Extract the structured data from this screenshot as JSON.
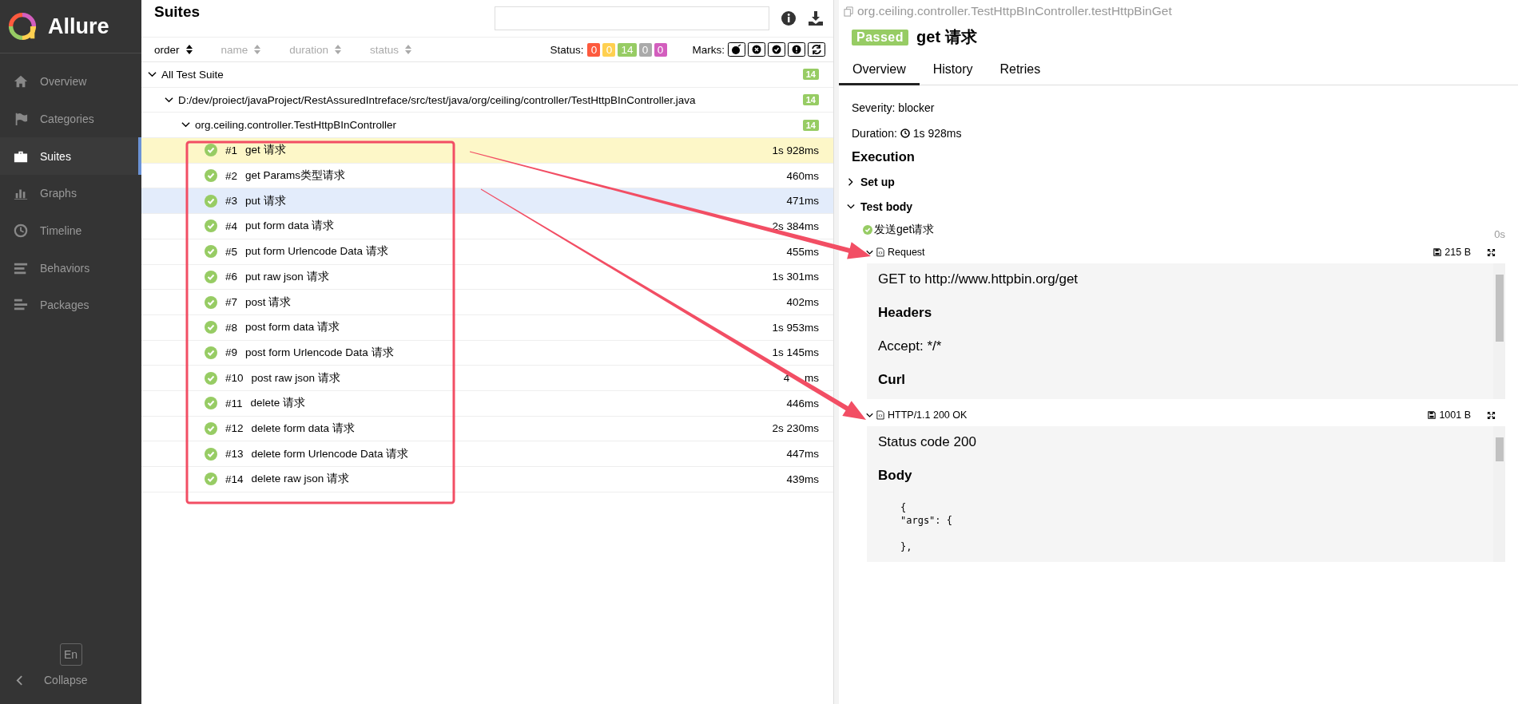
{
  "sidebar": {
    "logo": "Allure",
    "items": [
      {
        "label": "Overview",
        "selected": false
      },
      {
        "label": "Categories",
        "selected": false
      },
      {
        "label": "Suites",
        "selected": true
      },
      {
        "label": "Graphs",
        "selected": false
      },
      {
        "label": "Timeline",
        "selected": false
      },
      {
        "label": "Behaviors",
        "selected": false
      },
      {
        "label": "Packages",
        "selected": false
      }
    ],
    "language": "En",
    "collapse": "Collapse"
  },
  "suites": {
    "title": "Suites",
    "sort": [
      {
        "label": "order",
        "selected": true
      },
      {
        "label": "name",
        "selected": false
      },
      {
        "label": "duration",
        "selected": false
      },
      {
        "label": "status",
        "selected": false
      }
    ],
    "status_label": "Status:",
    "status_counts": [
      {
        "count": "0",
        "color": "#fd5a3e"
      },
      {
        "count": "0",
        "color": "#ffd050"
      },
      {
        "count": "14",
        "color": "#97cc64"
      },
      {
        "count": "0",
        "color": "#aaaaaa"
      },
      {
        "count": "0",
        "color": "#d35ebe"
      }
    ],
    "marks_label": "Marks:",
    "tree": [
      {
        "label": "All Test Suite",
        "count": "14",
        "expanded": true,
        "children": [
          {
            "label": "D:/dev/proiect/javaProject/RestAssuredIntreface/src/test/java/org/ceiling/controller/TestHttpBInController.java",
            "count": "14",
            "expanded": true,
            "children": [
              {
                "label": "org.ceiling.controller.TestHttpBInController",
                "count": "14",
                "expanded": true,
                "tests": [
                  {
                    "number": "#1",
                    "name": "get 请求",
                    "duration": "1s 928ms",
                    "selected": true,
                    "hover": false
                  },
                  {
                    "number": "#2",
                    "name": "get Params类型请求",
                    "duration": "460ms",
                    "selected": false,
                    "hover": false
                  },
                  {
                    "number": "#3",
                    "name": "put 请求",
                    "duration": "471ms",
                    "selected": false,
                    "hover": true
                  },
                  {
                    "number": "#4",
                    "name": "put form data 请求",
                    "duration": "2s 384ms",
                    "selected": false,
                    "hover": false
                  },
                  {
                    "number": "#5",
                    "name": "put form Urlencode Data 请求",
                    "duration": "455ms",
                    "selected": false,
                    "hover": false
                  },
                  {
                    "number": "#6",
                    "name": "put raw json 请求",
                    "duration": "1s 301ms",
                    "selected": false,
                    "hover": false
                  },
                  {
                    "number": "#7",
                    "name": "post 请求",
                    "duration": "402ms",
                    "selected": false,
                    "hover": false
                  },
                  {
                    "number": "#8",
                    "name": "post form data 请求",
                    "duration": "1s 953ms",
                    "selected": false,
                    "hover": false
                  },
                  {
                    "number": "#9",
                    "name": "post form Urlencode Data 请求",
                    "duration": "1s 145ms",
                    "selected": false,
                    "hover": false
                  },
                  {
                    "number": "#10",
                    "name": "post raw json 请求",
                    "duration": "4     ms",
                    "selected": false,
                    "hover": false
                  },
                  {
                    "number": "#11",
                    "name": "delete 请求",
                    "duration": "446ms",
                    "selected": false,
                    "hover": false
                  },
                  {
                    "number": "#12",
                    "name": "delete form data 请求",
                    "duration": "2s 230ms",
                    "selected": false,
                    "hover": false
                  },
                  {
                    "number": "#13",
                    "name": "delete form Urlencode Data 请求",
                    "duration": "447ms",
                    "selected": false,
                    "hover": false
                  },
                  {
                    "number": "#14",
                    "name": "delete raw json 请求",
                    "duration": "439ms",
                    "selected": false,
                    "hover": false
                  }
                ]
              }
            ]
          }
        ]
      }
    ]
  },
  "detail": {
    "path": "org.ceiling.controller.TestHttpBInController.testHttpBinGet",
    "status": "Passed",
    "title": "get 请求",
    "tabs": [
      {
        "label": "Overview",
        "selected": true
      },
      {
        "label": "History",
        "selected": false
      },
      {
        "label": "Retries",
        "selected": false
      }
    ],
    "severity": "Severity: blocker",
    "duration_label": "Duration:",
    "duration": "1s 928ms",
    "execution": "Execution",
    "sections": [
      {
        "title": "Set up",
        "expanded": false
      },
      {
        "title": "Test body",
        "expanded": true
      }
    ],
    "step": {
      "name": "发送get请求",
      "time": "0s"
    },
    "attachments": [
      {
        "name": "Request",
        "size": "215 B",
        "expanded": true,
        "lines": [
          {
            "kind": "text",
            "text": "GET to http://www.httpbin.org/get"
          },
          {
            "kind": "heading",
            "text": "Headers"
          },
          {
            "kind": "text",
            "text": "Accept: */*"
          },
          {
            "kind": "heading",
            "text": "Curl"
          }
        ]
      },
      {
        "name": "HTTP/1.1 200 OK",
        "size": "1001 B",
        "expanded": true,
        "lines": [
          {
            "kind": "text",
            "text": "Status code 200"
          },
          {
            "kind": "heading",
            "text": "Body"
          },
          {
            "kind": "code",
            "text": "{\n\"args\": {\n\n},"
          }
        ]
      }
    ]
  }
}
